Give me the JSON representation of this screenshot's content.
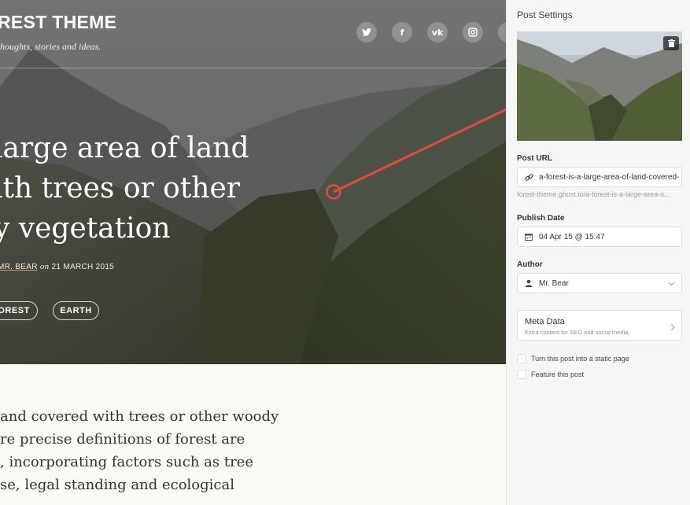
{
  "blog": {
    "title": "REST THEME",
    "description": "houghts, stories and ideas."
  },
  "social_icons": [
    {
      "name": "twitter-icon",
      "glyph": "🐦"
    },
    {
      "name": "facebook-icon",
      "glyph": "f"
    },
    {
      "name": "vk-icon",
      "glyph": "vk"
    },
    {
      "name": "instagram-icon",
      "glyph": "◎"
    }
  ],
  "post": {
    "headline_lines": [
      "large area of land",
      "ith trees or other",
      "y vegetation"
    ],
    "author": "MR. BEAR",
    "date_prefix": "on",
    "date": "21 MARCH 2015",
    "tags": [
      "FOREST",
      "EARTH"
    ],
    "excerpt_lines": [
      "and covered with trees or other woody",
      "re precise definitions of forest are",
      ", incorporating factors such as tree",
      "se, legal standing and ecological"
    ]
  },
  "settings": {
    "title": "Post Settings",
    "url_label": "Post URL",
    "url_value": "a-forest-is-a-large-area-of-land-covered-",
    "url_hint": "forest-theme.ghost.io/a-forest-is-a-large-area-o...",
    "publish_label": "Publish Date",
    "publish_value": "04 Apr 15 @ 15:47",
    "author_label": "Author",
    "author_value": "Mr. Bear",
    "meta_title": "Meta Data",
    "meta_subtitle": "Extra content for SEO and social media.",
    "static_page_label": "Turn this post into a static page",
    "feature_label": "Feature this post"
  },
  "colors": {
    "accent_line": "#e14a3f",
    "author_underline": "#c99a5b"
  }
}
